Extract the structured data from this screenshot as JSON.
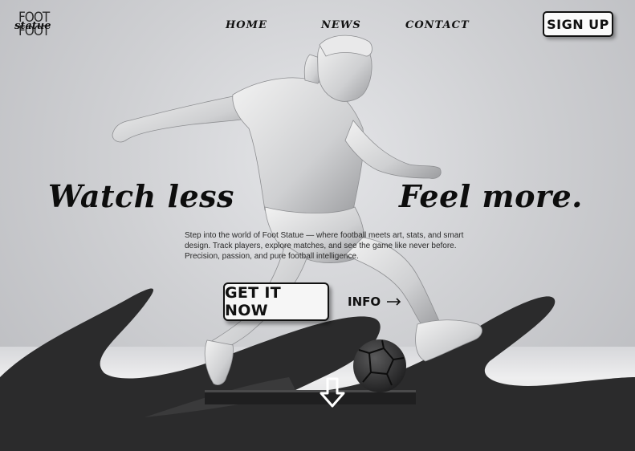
{
  "brand": {
    "logo_line1": "FOOT",
    "logo_line2": "FOOT",
    "logo_script": "statue"
  },
  "nav": {
    "home": "HOME",
    "news": "NEWS",
    "contact": "CONTACT"
  },
  "header": {
    "signup_label": "SIGN UP"
  },
  "hero": {
    "headline_left": "Watch less",
    "headline_right": "Feel more.",
    "description": "Step into the world of Foot Statue — where football meets art, stats, and smart design. Track players, explore matches, and see the game like never before. Precision, passion, and pure football intelligence.",
    "cta_label": "GET IT NOW",
    "info_label": "INFO"
  },
  "icons": {
    "info_arrow": "arrow-right-icon",
    "scroll_down": "arrow-down-icon"
  },
  "colors": {
    "ink": "#111111",
    "wave": "#2b2b2c",
    "background": "#c9cacd"
  }
}
